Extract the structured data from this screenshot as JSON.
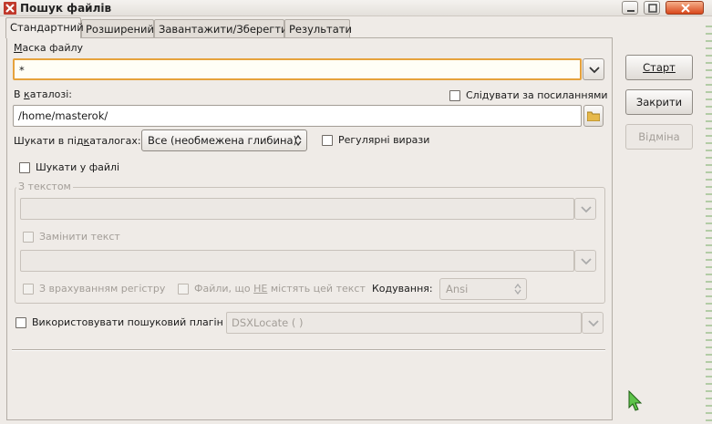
{
  "window": {
    "title": "Пошук файлів"
  },
  "tabs": [
    {
      "label": "Стандартний",
      "active": true
    },
    {
      "label": "Розширений"
    },
    {
      "label": "Завантажити/Зберегти"
    },
    {
      "label": "Результати"
    }
  ],
  "form": {
    "mask_label_first": "М",
    "mask_label_rest": "аска файлу",
    "mask_value": "*",
    "dir_label_pre": "В ",
    "dir_label_ul": "к",
    "dir_label_post": "аталозі:",
    "dir_value": "/home/masterok/",
    "follow_links_label": "Слідувати за посиланнями",
    "subdirs_label_pre": "Шукати в під",
    "subdirs_label_ul": "к",
    "subdirs_label_post": "аталогах:",
    "subdirs_value": "Все (необмежена глибина)",
    "regex_label": "Регулярні вирази",
    "search_in_file_label": "Шукати у файлі",
    "with_text_group": "З текстом",
    "replace_text_label": "Замінити текст",
    "case_sensitive_label": "З врахуванням регістру",
    "not_containing_label_pre": "Файли, що ",
    "not_containing_label_ne": "НЕ",
    "not_containing_label_post": " містять цей текст",
    "encoding_label": "Кодування:",
    "encoding_value": "Ansi",
    "plugin_label": "Використовувати пошуковий плагін",
    "plugin_value": "DSXLocate ( )"
  },
  "buttons": {
    "start": "Старт",
    "close": "Закрити",
    "cancel": "Відміна"
  },
  "colors": {
    "focus_accent": "#e6a23c",
    "close_button": "#d9471b"
  }
}
